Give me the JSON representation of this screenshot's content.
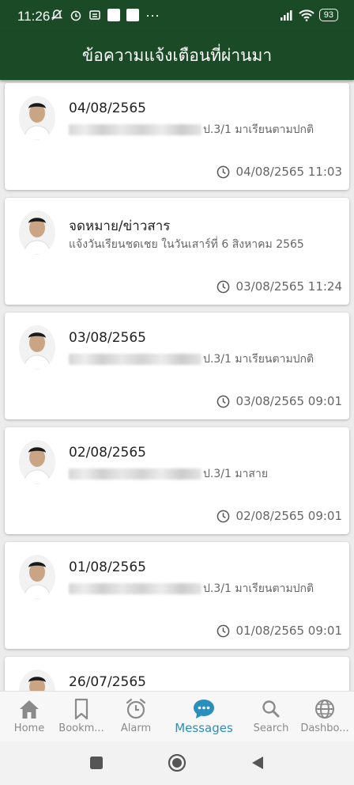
{
  "status": {
    "time": "11:26",
    "battery": "93",
    "more": "···"
  },
  "header": {
    "title": "ข้อความแจ้งเตือนที่ผ่านมา"
  },
  "messages": [
    {
      "title": "04/08/2565",
      "subtitle": "ป.3/1 มาเรียนตามปกติ",
      "name_redacted": true,
      "timestamp": "04/08/2565 11:03"
    },
    {
      "title": "จดหมาย/ข่าวสาร",
      "subtitle": "แจ้งวันเรียนชดเชย ในวันเสาร์ที่ 6 สิงหาคม 2565",
      "name_redacted": false,
      "timestamp": "03/08/2565 11:24"
    },
    {
      "title": "03/08/2565",
      "subtitle": "ป.3/1 มาเรียนตามปกติ",
      "name_redacted": true,
      "timestamp": "03/08/2565 09:01"
    },
    {
      "title": "02/08/2565",
      "subtitle": "ป.3/1 มาสาย",
      "name_redacted": true,
      "timestamp": "02/08/2565 09:01"
    },
    {
      "title": "01/08/2565",
      "subtitle": "ป.3/1 มาเรียนตามปกติ",
      "name_redacted": true,
      "timestamp": "01/08/2565 09:01"
    },
    {
      "title": "26/07/2565",
      "subtitle": "",
      "name_redacted": true,
      "timestamp": ""
    }
  ],
  "nav": {
    "items": [
      {
        "label": "Home",
        "icon": "home-icon"
      },
      {
        "label": "Bookm...",
        "icon": "bookmark-icon"
      },
      {
        "label": "Alarm",
        "icon": "alarm-icon"
      },
      {
        "label": "Messages",
        "icon": "messages-icon",
        "active": true
      },
      {
        "label": "Search",
        "icon": "search-icon"
      },
      {
        "label": "Dashbo...",
        "icon": "globe-icon"
      }
    ],
    "active_color": "#2b8fbd",
    "inactive_color": "#8a8a8a"
  },
  "colors": {
    "header_bg": "#1b4a27",
    "page_bg": "#ececec",
    "card_bg": "#ffffff"
  }
}
